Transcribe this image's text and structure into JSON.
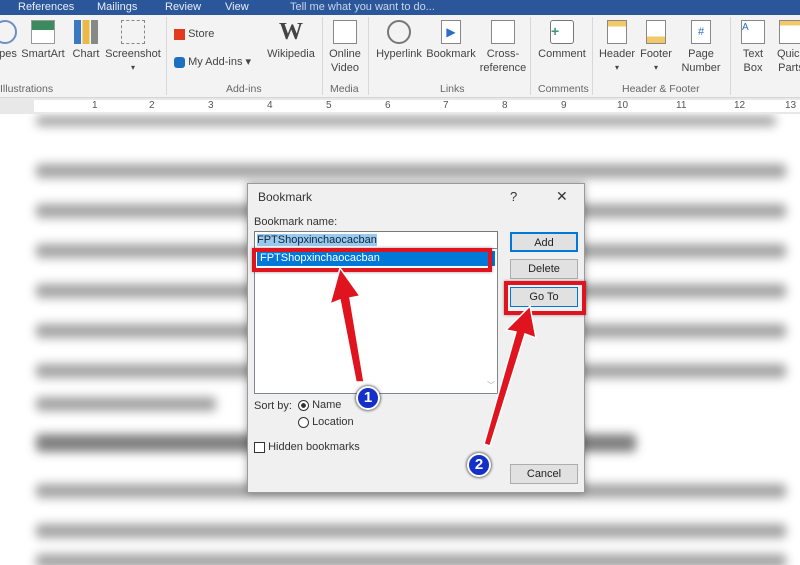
{
  "tabs": [
    "References",
    "Mailings",
    "Review",
    "View"
  ],
  "tell_me": "Tell me what you want to do...",
  "ribbon": {
    "shapes": "apes",
    "smartart": "SmartArt",
    "chart": "Chart",
    "screenshot": "Screenshot",
    "store": "Store",
    "my_addins": "My Add-ins",
    "wikipedia": "Wikipedia",
    "online_video": "Online Video",
    "hyperlink": "Hyperlink",
    "bookmark": "Bookmark",
    "cross_reference": "Cross-reference",
    "comment": "Comment",
    "header": "Header",
    "footer": "Footer",
    "page_number": "Page Number",
    "text_box": "Text Box",
    "quick_parts": "Quick Parts",
    "groups": {
      "illustrations": "Illustrations",
      "addins": "Add-ins",
      "media": "Media",
      "links": "Links",
      "comments": "Comments",
      "header_footer": "Header & Footer"
    }
  },
  "ruler": [
    "1",
    "2",
    "3",
    "4",
    "5",
    "6",
    "7",
    "8",
    "9",
    "10",
    "11",
    "12",
    "13"
  ],
  "dialog": {
    "title": "Bookmark",
    "help": "?",
    "close": "✕",
    "name_label": "Bookmark name:",
    "name_value": "FPTShopxinchaocacban",
    "list": [
      "FPTShopxinchaocacban"
    ],
    "add": "Add",
    "delete": "Delete",
    "goto": "Go To",
    "cancel": "Cancel",
    "sort_by": "Sort by:",
    "sort_name": "Name",
    "sort_location": "Location",
    "sort_selected": "Name",
    "hidden": "Hidden bookmarks",
    "hidden_checked": false
  },
  "annotations": {
    "step1": "1",
    "step2": "2"
  },
  "colors": {
    "accent": "#2b579a",
    "highlight": "#e0141e",
    "selection": "#0078d7",
    "badge": "#1430c8"
  }
}
